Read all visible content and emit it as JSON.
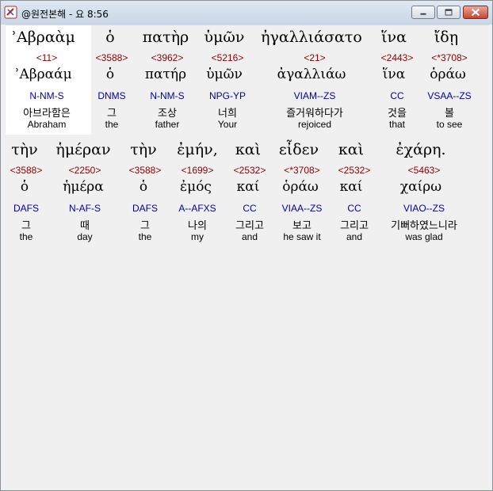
{
  "window": {
    "title": "@원전본해 - 요 8:56",
    "app_icon": "bible-app-icon",
    "buttons": {
      "minimize": "minimize-icon",
      "maximize": "maximize-icon",
      "close": "close-icon"
    }
  },
  "rows": [
    {
      "words": [
        {
          "greek": "ʾΑβραὰμ",
          "strong": "<11>",
          "lemma": "ʾΑβραάμ",
          "parse": "N-NM-S",
          "korean": "아브라함은",
          "english": "Abraham"
        },
        {
          "greek": "ὁ",
          "strong": "<3588>",
          "lemma": "ὁ",
          "parse": "DNMS",
          "korean": "그",
          "english": "the"
        },
        {
          "greek": "πατὴρ",
          "strong": "<3962>",
          "lemma": "πατήρ",
          "parse": "N-NM-S",
          "korean": "조상",
          "english": "father"
        },
        {
          "greek": "ὑμῶν",
          "strong": "<5216>",
          "lemma": "ὑμῶν",
          "parse": "NPG-YP",
          "korean": "너희",
          "english": "Your"
        },
        {
          "greek": "ἠγαλλιάσατο",
          "strong": "<21>",
          "lemma": "ἀγαλλιάω",
          "parse": "VIAM--ZS",
          "korean": "즐거워하다가",
          "english": "rejoiced"
        },
        {
          "greek": "ἵνα",
          "strong": "<2443>",
          "lemma": "ἵνα",
          "parse": "CC",
          "korean": "것을",
          "english": "that"
        },
        {
          "greek": "ἴδῃ",
          "strong": "<*3708>",
          "lemma": "ὁράω",
          "parse": "VSAA--ZS",
          "korean": "볼",
          "english": "to see"
        }
      ]
    },
    {
      "words": [
        {
          "greek": "τὴν",
          "strong": "<3588>",
          "lemma": "ὁ",
          "parse": "DAFS",
          "korean": "그",
          "english": "the"
        },
        {
          "greek": "ἡμέραν",
          "strong": "<2250>",
          "lemma": "ἡμέρα",
          "parse": "N-AF-S",
          "korean": "때",
          "english": "day"
        },
        {
          "greek": "τὴν",
          "strong": "<3588>",
          "lemma": "ὁ",
          "parse": "DAFS",
          "korean": "그",
          "english": "the"
        },
        {
          "greek": "ἐμήν,",
          "strong": "<1699>",
          "lemma": "ἐμός",
          "parse": "A--AFXS",
          "korean": "나의",
          "english": "my"
        },
        {
          "greek": "καὶ",
          "strong": "<2532>",
          "lemma": "καί",
          "parse": "CC",
          "korean": "그리고",
          "english": "and"
        },
        {
          "greek": "εἶδεν",
          "strong": "<*3708>",
          "lemma": "ὁράω",
          "parse": "VIAA--ZS",
          "korean": "보고",
          "english": "he saw it"
        },
        {
          "greek": "καὶ",
          "strong": "<2532>",
          "lemma": "καί",
          "parse": "CC",
          "korean": "그리고",
          "english": "and"
        },
        {
          "greek": "ἐχάρη.",
          "strong": "<5463>",
          "lemma": "χαίρω",
          "parse": "VIAO--ZS",
          "korean": "기뻐하였느니라",
          "english": "was glad"
        }
      ]
    }
  ]
}
